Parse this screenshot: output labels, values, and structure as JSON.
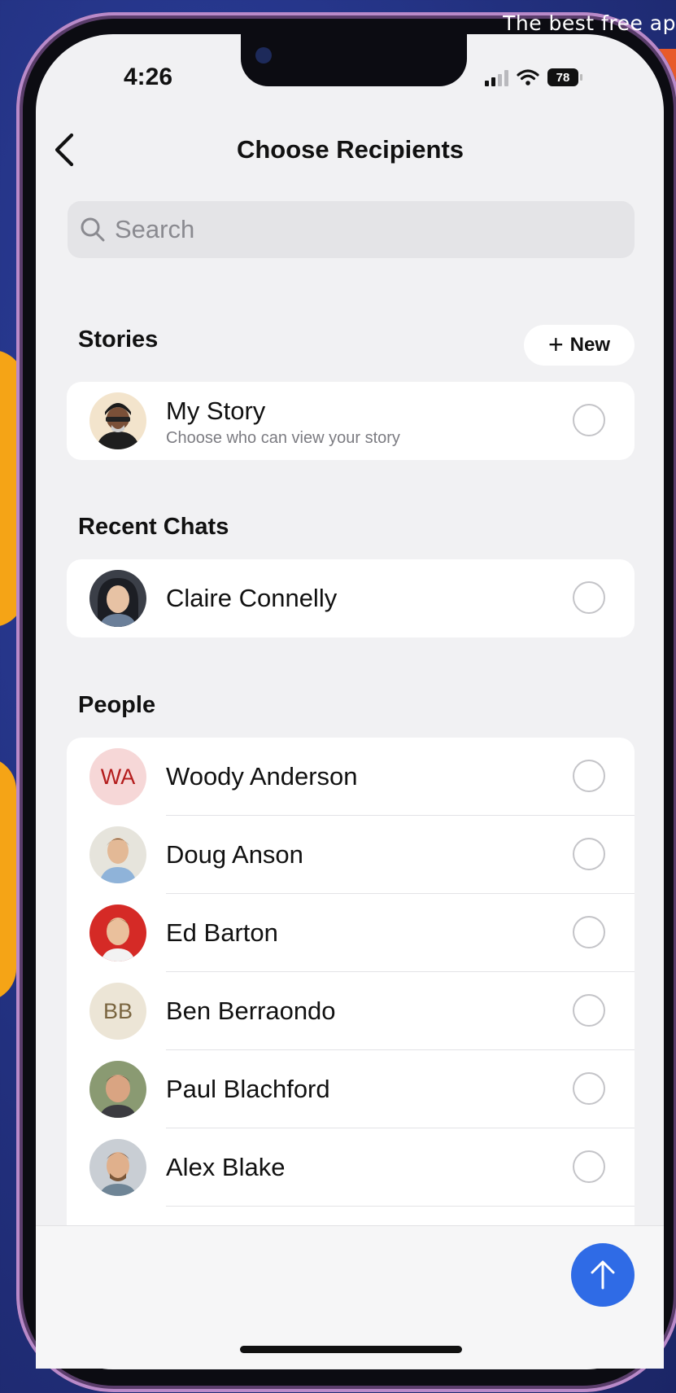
{
  "watermark": "The best free ap",
  "status_bar": {
    "time": "4:26",
    "battery": "78"
  },
  "header": {
    "title": "Choose Recipients",
    "back_icon": "chevron-left-icon"
  },
  "search": {
    "placeholder": "Search",
    "icon": "search-icon"
  },
  "stories": {
    "title": "Stories",
    "new_label": "New",
    "items": [
      {
        "name": "My Story",
        "subtitle": "Choose who can view your story"
      }
    ]
  },
  "recent_chats": {
    "title": "Recent Chats",
    "items": [
      {
        "name": "Claire Connelly"
      }
    ]
  },
  "people": {
    "title": "People",
    "items": [
      {
        "name": "Woody Anderson",
        "initials": "WA",
        "avatar_bg": "#f6d7d7",
        "avatar_fg": "#b41c1c"
      },
      {
        "name": "Doug Anson"
      },
      {
        "name": "Ed Barton"
      },
      {
        "name": "Ben Berraondo",
        "initials": "BB",
        "avatar_bg": "#ece5d6",
        "avatar_fg": "#7a6540"
      },
      {
        "name": "Paul Blachford"
      },
      {
        "name": "Alex Blake"
      }
    ]
  },
  "send_button": {
    "icon": "arrow-up-icon",
    "color": "#2f6be6"
  }
}
